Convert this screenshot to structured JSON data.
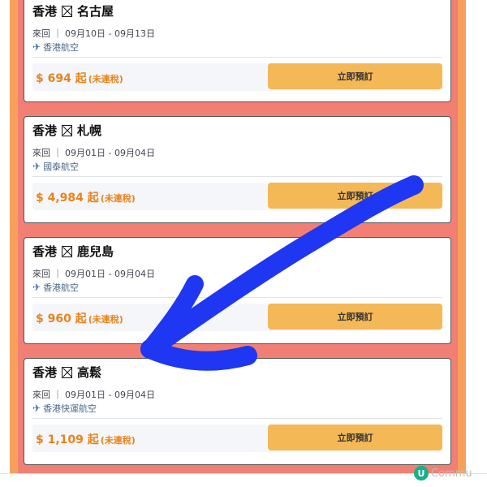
{
  "colors": {
    "panel": "#f27f74",
    "strip": "#f6a15b",
    "price": "#e8831b",
    "button": "#f4b857",
    "scribble": "#1f37f2",
    "logo": "#16b08a"
  },
  "icons": {
    "airline": "plane-icon",
    "separator": "boxed-x-icon"
  },
  "cards": [
    {
      "origin": "香港",
      "destination": "名古屋",
      "dates": "來回 ｜ 09月10日 - 09月13日",
      "airline": "香港航空",
      "price": "$ 694 起",
      "tax_note": "(未連稅)",
      "button": "立即預訂"
    },
    {
      "origin": "香港",
      "destination": "札幌",
      "dates": "來回 ｜ 09月01日 - 09月04日",
      "airline": "國泰航空",
      "price": "$ 4,984 起",
      "tax_note": "(未連稅)",
      "button": "立即預訂"
    },
    {
      "origin": "香港",
      "destination": "鹿兒島",
      "dates": "來回 ｜ 09月01日 - 09月04日",
      "airline": "香港航空",
      "price": "$ 960 起",
      "tax_note": "(未連稅)",
      "button": "立即預訂"
    },
    {
      "origin": "香港",
      "destination": "高鬆",
      "dates": "來回 ｜ 09月01日 - 09月04日",
      "airline": "香港快運航空",
      "price": "$ 1,109 起",
      "tax_note": "(未連稅)",
      "button": "立即預訂"
    }
  ],
  "watermark": {
    "letter": "U",
    "text": "Commu"
  }
}
